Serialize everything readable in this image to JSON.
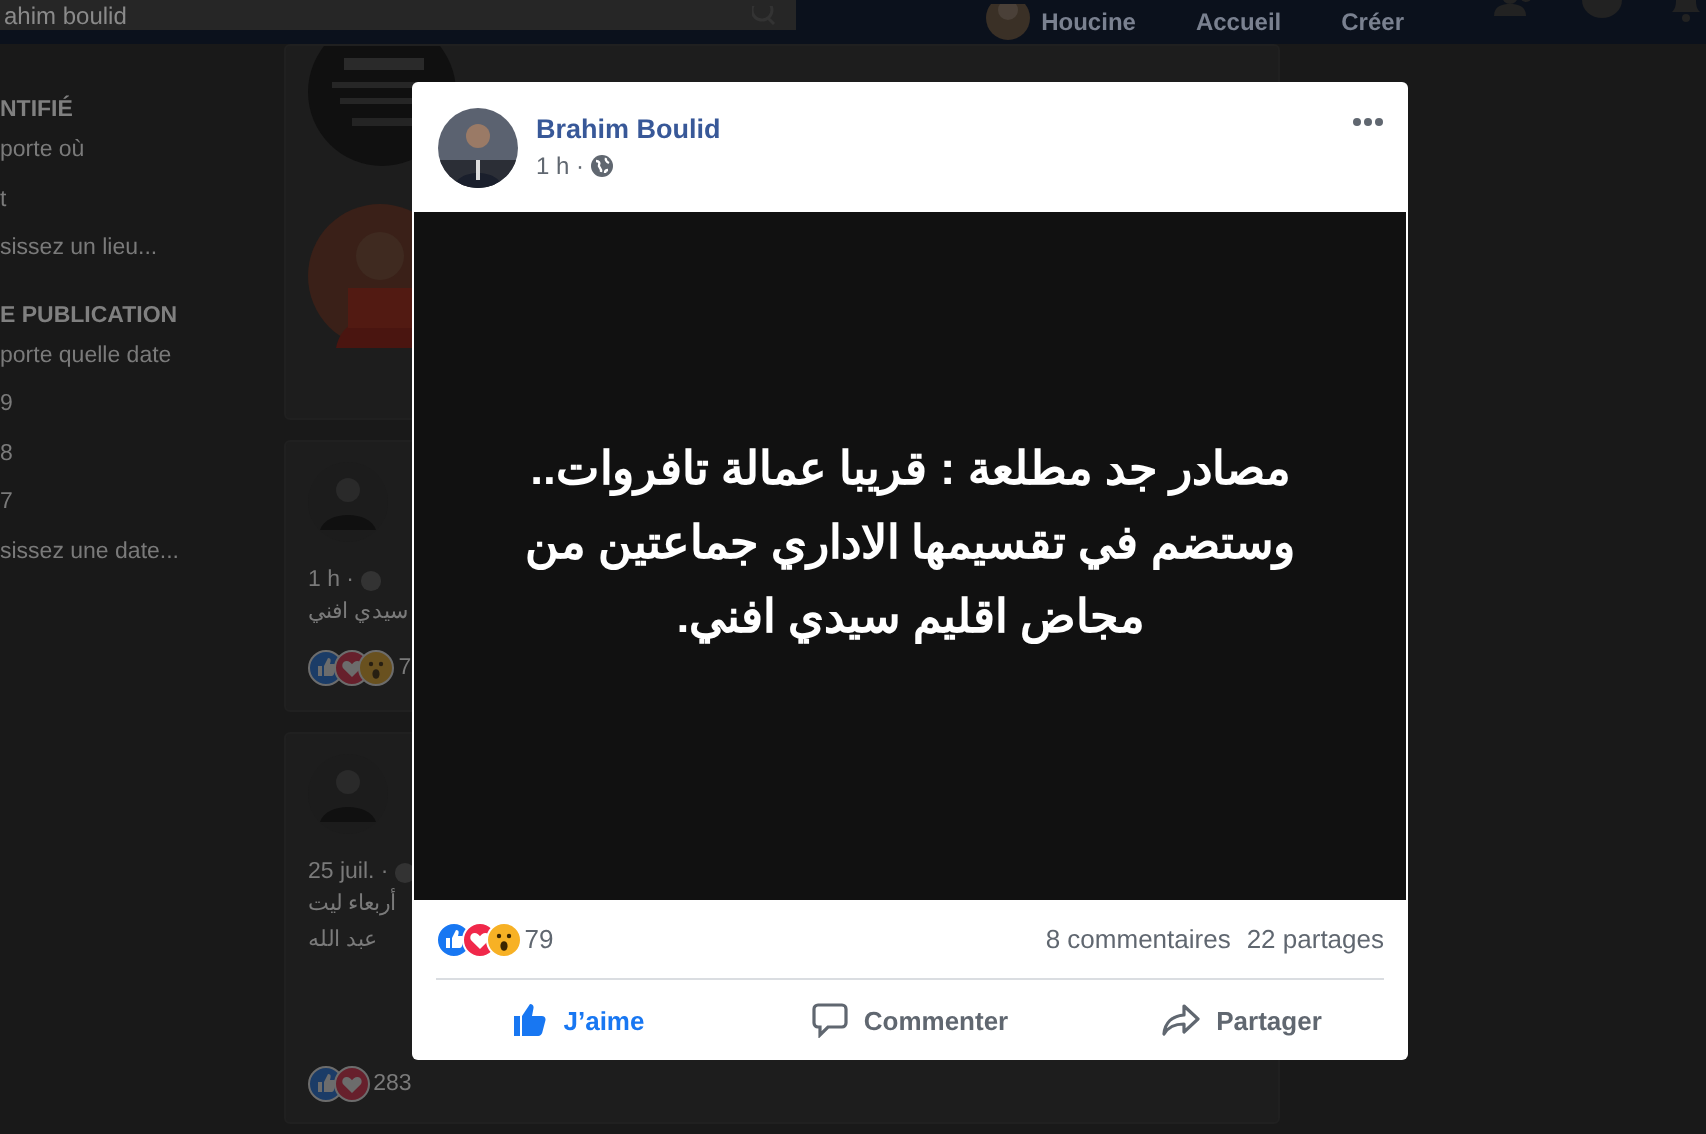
{
  "top_bar": {
    "search": {
      "value": "ahim boulid"
    },
    "nav": [
      {
        "kind": "profile",
        "label": "Houcine"
      },
      {
        "kind": "link",
        "label": "Accueil"
      },
      {
        "kind": "link",
        "label": "Créer"
      }
    ]
  },
  "sidebar": {
    "sections": [
      {
        "heading": "NTIFIÉ",
        "options": [
          "porte où",
          "t",
          "sissez un lieu..."
        ]
      },
      {
        "heading": "E PUBLICATION",
        "options": [
          "porte quelle date",
          "9",
          "8",
          "7",
          "sissez une date..."
        ]
      }
    ]
  },
  "feed": [
    {
      "kind": "pages"
    },
    {
      "kind": "post",
      "time": "1 h ·",
      "lines": [
        "سيدي افني"
      ],
      "count": "7"
    },
    {
      "kind": "tall_post",
      "time": "25 juil. ·",
      "lines": [
        "أربعاء ليت",
        "عبد الله"
      ],
      "count": "283"
    }
  ],
  "post": {
    "author": "Brahim Boulid",
    "time": "1 h ·",
    "text_lines": [
      "مصادر جد مطلعة : قريبا عمالة تافروات..",
      "وستضم في تقسيمها الاداري جماعتين من",
      "مجاض اقليم سيدي افني."
    ],
    "reaction_count": "79",
    "comments": "8 commentaires",
    "shares": "22 partages",
    "actions": [
      {
        "kind": "like",
        "label": "J’aime",
        "selected": true
      },
      {
        "kind": "comment",
        "label": "Commenter",
        "selected": false
      },
      {
        "kind": "share",
        "label": "Partager",
        "selected": false
      }
    ]
  }
}
